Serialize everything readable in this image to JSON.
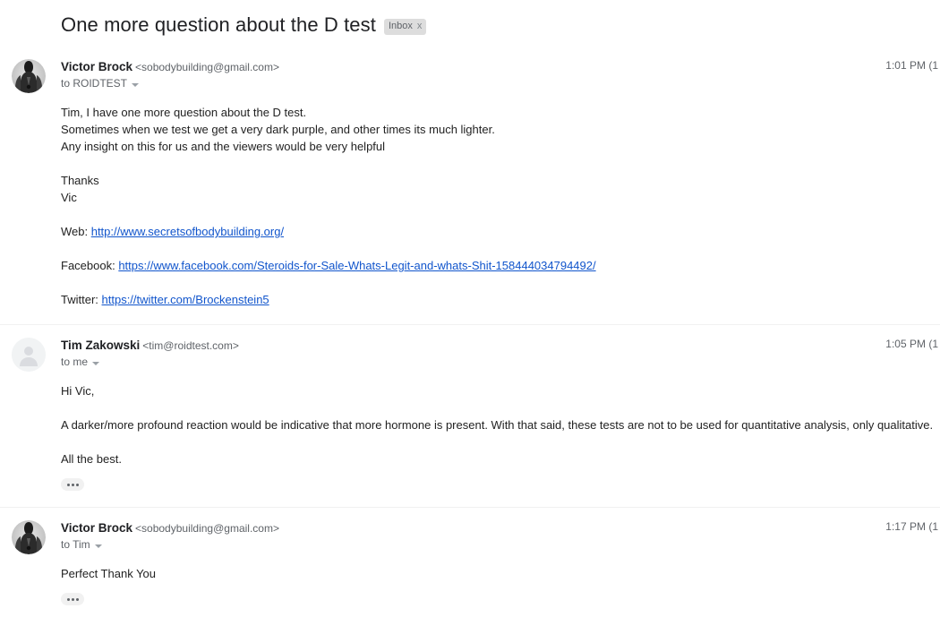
{
  "thread": {
    "subject": "One more question about the D test",
    "label": {
      "name": "Inbox",
      "remove": "x"
    }
  },
  "messages": [
    {
      "id": "message-1",
      "sender_name": "Victor Brock",
      "sender_email": "<sobodybuilding@gmail.com>",
      "recipient": "to ROIDTEST",
      "timestamp": "1:01 PM (1",
      "avatar_type": "photo",
      "body_lines": [
        "Tim, I have one more question about the D test.",
        "Sometimes when we test we get a very dark purple, and other times its much lighter.",
        "Any insight on this for us and the viewers would be very helpful",
        "",
        "Thanks",
        "Vic"
      ],
      "links": [
        {
          "prefix": "Web: ",
          "text": "http://www.secretsofbodybuilding.org/"
        },
        {
          "prefix": "Facebook: ",
          "text": "https://www.facebook.com/Steroids-for-Sale-Whats-Legit-and-whats-Shit-158444034794492/"
        },
        {
          "prefix": "Twitter: ",
          "text": "https://twitter.com/Brockenstein5"
        }
      ],
      "has_trimmed": false
    },
    {
      "id": "message-2",
      "sender_name": "Tim Zakowski",
      "sender_email": "<tim@roidtest.com>",
      "recipient": "to me",
      "timestamp": "1:05 PM (1",
      "avatar_type": "default",
      "body_paragraphs": [
        "Hi Vic,",
        "A darker/more profound reaction would be indicative that more hormone is present. With that said, these tests are not to be used for quantitative analysis, only qualitative.",
        "All the best."
      ],
      "has_trimmed": true
    },
    {
      "id": "message-3",
      "sender_name": "Victor Brock",
      "sender_email": "<sobodybuilding@gmail.com>",
      "recipient": "to Tim",
      "timestamp": "1:17 PM (1",
      "avatar_type": "photo",
      "body_paragraphs": [
        "Perfect Thank You"
      ],
      "has_trimmed": true
    }
  ],
  "colors": {
    "link": "#1155cc",
    "text": "#222222",
    "muted": "#5f6368",
    "chip_bg": "#dddddd"
  }
}
